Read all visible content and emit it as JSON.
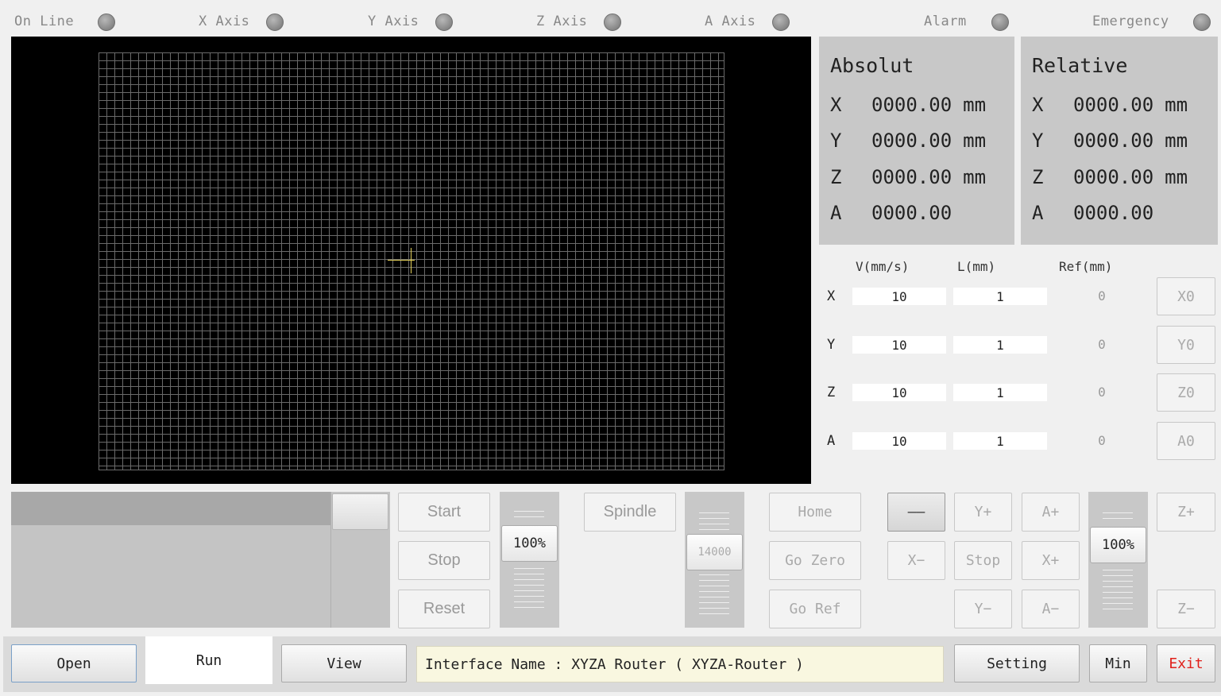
{
  "status": {
    "items": [
      {
        "label": "On Line"
      },
      {
        "label": "X Axis"
      },
      {
        "label": "Y Axis"
      },
      {
        "label": "Z Axis"
      },
      {
        "label": "A Axis"
      },
      {
        "label": "Alarm"
      },
      {
        "label": "Emergency"
      }
    ]
  },
  "absolute": {
    "title": "Absolut",
    "rows": [
      {
        "axis": "X",
        "value": "0000.00",
        "unit": "mm"
      },
      {
        "axis": "Y",
        "value": "0000.00",
        "unit": "mm"
      },
      {
        "axis": "Z",
        "value": "0000.00",
        "unit": "mm"
      },
      {
        "axis": "A",
        "value": "0000.00",
        "unit": ""
      }
    ]
  },
  "relative": {
    "title": "Relative",
    "rows": [
      {
        "axis": "X",
        "value": "0000.00",
        "unit": "mm"
      },
      {
        "axis": "Y",
        "value": "0000.00",
        "unit": "mm"
      },
      {
        "axis": "Z",
        "value": "0000.00",
        "unit": "mm"
      },
      {
        "axis": "A",
        "value": "0000.00",
        "unit": ""
      }
    ]
  },
  "jog": {
    "headers": {
      "velocity": "V(mm/s)",
      "length": "L(mm)",
      "ref": "Ref(mm)"
    },
    "rows": [
      {
        "axis": "X",
        "velocity": "10",
        "length": "1",
        "ref": "0",
        "zero_label": "X0"
      },
      {
        "axis": "Y",
        "velocity": "10",
        "length": "1",
        "ref": "0",
        "zero_label": "Y0"
      },
      {
        "axis": "Z",
        "velocity": "10",
        "length": "1",
        "ref": "0",
        "zero_label": "Z0"
      },
      {
        "axis": "A",
        "velocity": "10",
        "length": "1",
        "ref": "0",
        "zero_label": "A0"
      }
    ]
  },
  "program": {
    "start": "Start",
    "stop": "Stop",
    "reset": "Reset",
    "feed_override": "100%",
    "feed_override_value": 100
  },
  "spindle": {
    "label": "Spindle",
    "speed": "14000"
  },
  "motion": {
    "home": "Home",
    "go_zero": "Go Zero",
    "go_ref": "Go Ref",
    "step_mode": "——",
    "y_plus": "Y+",
    "y_minus": "Y−",
    "x_plus": "X+",
    "x_minus": "X−",
    "a_plus": "A+",
    "a_minus": "A−",
    "z_plus": "Z+",
    "z_minus": "Z−",
    "stop": "Stop",
    "jog_override": "100%",
    "jog_override_value": 100
  },
  "bottom": {
    "open": "Open",
    "run": "Run",
    "view": "View",
    "interface": "Interface Name : XYZA Router ( XYZA-Router )",
    "setting": "Setting",
    "min": "Min",
    "exit": "Exit"
  },
  "colors": {
    "exit_text": "#e0201a",
    "crosshair": "#e6d25a",
    "interface_bg": "#f9f7e0"
  }
}
